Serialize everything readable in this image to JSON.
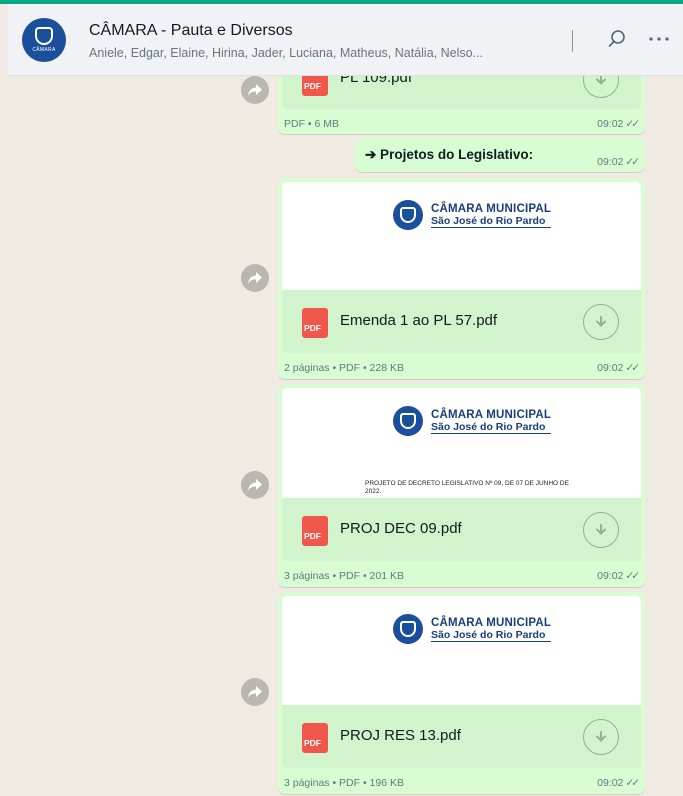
{
  "header": {
    "title": "CÂMARA - Pauta e Diversos",
    "subtitle": "Aniele, Edgar, Elaine, Hirina, Jader, Luciana, Matheus, Natália, Nelso...",
    "avatar_text": "CÂMARA",
    "search_icon": "search-icon",
    "menu_icon": "more-horizontal-icon"
  },
  "colors": {
    "accent": "#00a884",
    "bubble": "#d9fdd3",
    "file_row": "#d1f4cc",
    "pdf": "#f1564b",
    "logo_blue": "#1a3e7a"
  },
  "messages": [
    {
      "type": "file",
      "file_name": "PL 109.pdf",
      "pdf_label": "PDF",
      "meta": "PDF • 6 MB",
      "time": "09:02"
    },
    {
      "type": "text",
      "text": "➔ Projetos do Legislativo:",
      "time": "09:02"
    },
    {
      "type": "file",
      "logo_line1": "CÂMARA MUNICIPAL",
      "logo_line2": "São José do Rio Pardo",
      "file_name": "Emenda 1 ao PL 57.pdf",
      "pdf_label": "PDF",
      "meta": "2 páginas • PDF • 228 KB",
      "time": "09:02"
    },
    {
      "type": "file",
      "logo_line1": "CÂMARA MUNICIPAL",
      "logo_line2": "São José do Rio Pardo",
      "doc_text_1": "PROJETO DE DECRETO LEGISLATIVO Nº 09, DE 07 DE JUNHO DE",
      "doc_text_2": "2022.",
      "file_name": "PROJ DEC 09.pdf",
      "pdf_label": "PDF",
      "meta": "3 páginas • PDF • 201 KB",
      "time": "09:02"
    },
    {
      "type": "file",
      "logo_line1": "CÂMARA MUNICIPAL",
      "logo_line2": "São José do Rio Pardo",
      "file_name": "PROJ RES 13.pdf",
      "pdf_label": "PDF",
      "meta": "3 páginas • PDF • 196 KB",
      "time": "09:02"
    }
  ],
  "tick": "✓✓"
}
